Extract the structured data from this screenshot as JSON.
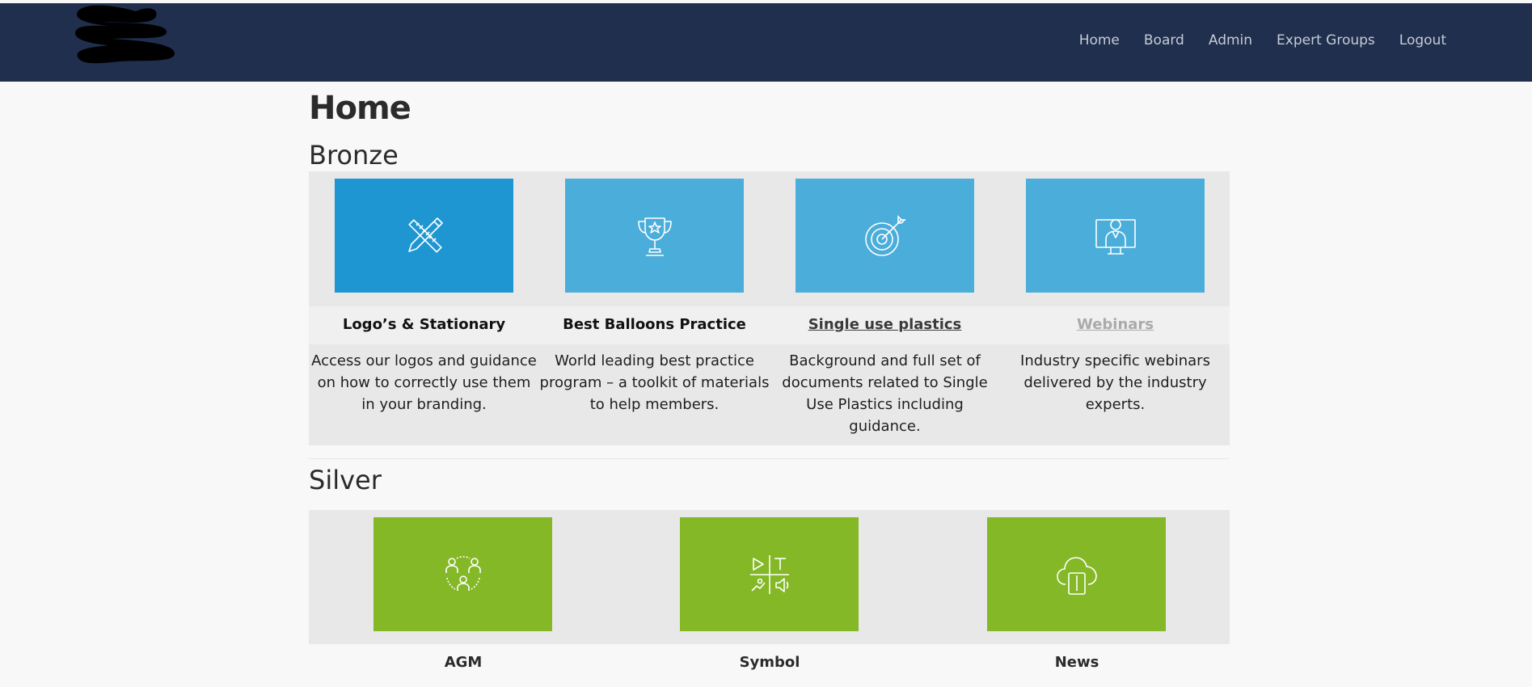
{
  "nav": {
    "items": [
      "Home",
      "Board",
      "Admin",
      "Expert Groups",
      "Logout"
    ]
  },
  "page": {
    "title": "Home"
  },
  "bronze": {
    "heading": "Bronze",
    "cards": [
      {
        "title": "Logo’s & Stationary",
        "description": "Access our logos and guidance on how to correctly use them in your branding.",
        "icon": "pencil-ruler-icon"
      },
      {
        "title": "Best Balloons Practice",
        "description": "World leading best practice program – a toolkit of materials to help members.",
        "icon": "trophy-icon"
      },
      {
        "title": "Single use plastics",
        "description": "Background and full set of documents related to Single Use Plastics including guidance.",
        "icon": "target-icon"
      },
      {
        "title": "Webinars",
        "description": "Industry specific webinars delivered by the industry experts.",
        "icon": "presenter-monitor-icon"
      }
    ]
  },
  "silver": {
    "heading": "Silver",
    "cards": [
      {
        "title": "AGM",
        "icon": "group-people-icon"
      },
      {
        "title": "Symbol",
        "icon": "media-symbols-icon"
      },
      {
        "title": "News",
        "icon": "cloud-tablet-icon"
      }
    ]
  },
  "colors": {
    "navbar": "#1f2f4d",
    "bronze_tile_primary": "#1e96d2",
    "bronze_tile": "#4badd9",
    "silver_tile": "#84b826"
  }
}
